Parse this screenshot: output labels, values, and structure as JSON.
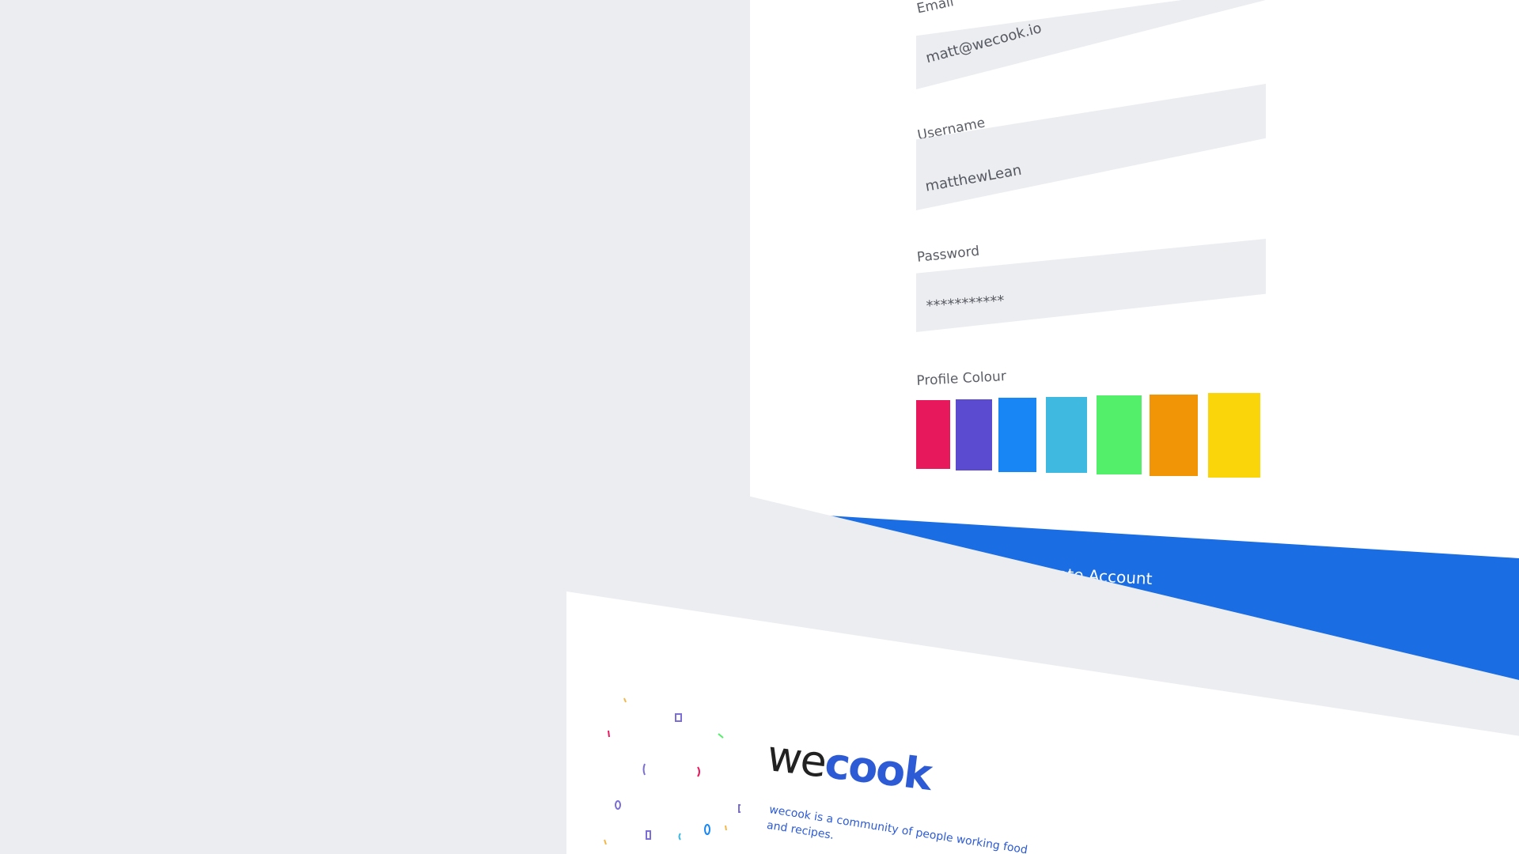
{
  "form": {
    "fields": [
      {
        "label": "Email",
        "value": "matt@wecook.io"
      },
      {
        "label": "Username",
        "value": "matthewLean"
      },
      {
        "label": "Password",
        "value": "***********"
      }
    ],
    "profile_colour": {
      "label": "Profile Colour",
      "colors": [
        "#e8185c",
        "#5b4bd1",
        "#1887f5",
        "#3fb9df",
        "#53ef6a",
        "#f19507",
        "#f9d50a"
      ]
    },
    "submit_label": "Create Account"
  },
  "landing": {
    "logo_we": "we",
    "logo_cook": "cook",
    "tagline": "wecook is a community of people working food and recipes."
  },
  "colors": {
    "background": "#ecedf1",
    "accent": "#1a6de3",
    "brand": "#2d5bd6"
  }
}
